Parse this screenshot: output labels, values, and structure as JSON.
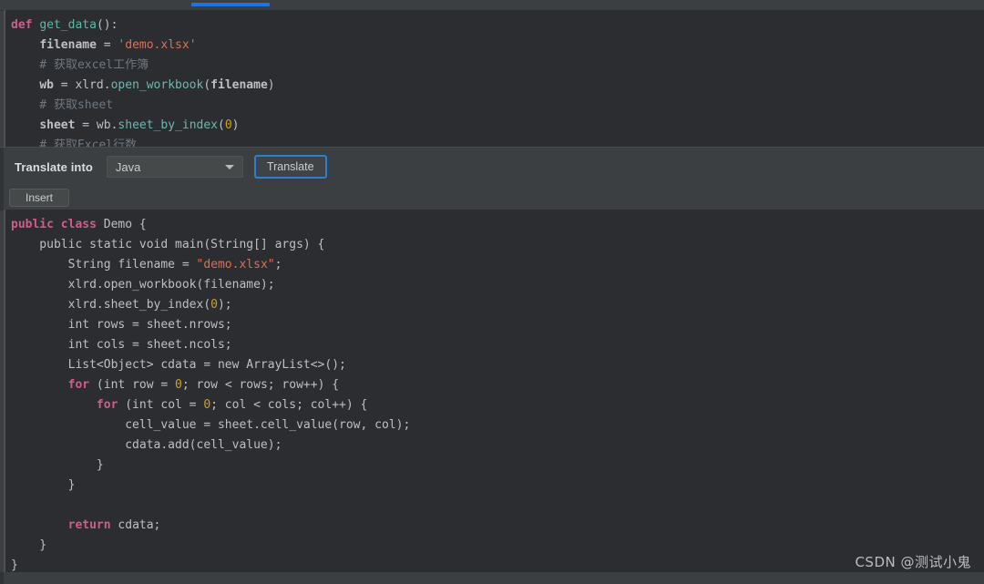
{
  "toolbar": {
    "label": "Translate into",
    "language_selected": "Java",
    "language_options": [
      "Java"
    ],
    "translate_button": "Translate",
    "insert_button": "Insert",
    "accent_color": "#2d7fd3"
  },
  "source_editor": {
    "language": "Python",
    "lines": [
      [
        {
          "t": "def",
          "c": "kw"
        },
        {
          "t": " ",
          "c": "pln"
        },
        {
          "t": "get_data",
          "c": "fn"
        },
        {
          "t": "():",
          "c": "pln"
        }
      ],
      [
        {
          "t": "    ",
          "c": "pln"
        },
        {
          "t": "filename",
          "c": "bld"
        },
        {
          "t": " = ",
          "c": "pln"
        },
        {
          "t": "'demo.xlsx'",
          "c": "str"
        }
      ],
      [
        {
          "t": "    # 获取excel工作簿",
          "c": "cmt"
        }
      ],
      [
        {
          "t": "    ",
          "c": "pln"
        },
        {
          "t": "wb",
          "c": "bld"
        },
        {
          "t": " = xlrd.",
          "c": "pln"
        },
        {
          "t": "open_workbook",
          "c": "mth"
        },
        {
          "t": "(",
          "c": "pln"
        },
        {
          "t": "filename",
          "c": "bld"
        },
        {
          "t": ")",
          "c": "pln"
        }
      ],
      [
        {
          "t": "    # 获取sheet",
          "c": "cmt"
        }
      ],
      [
        {
          "t": "    ",
          "c": "pln"
        },
        {
          "t": "sheet",
          "c": "bld"
        },
        {
          "t": " = wb.",
          "c": "pln"
        },
        {
          "t": "sheet_by_index",
          "c": "mth"
        },
        {
          "t": "(",
          "c": "pln"
        },
        {
          "t": "0",
          "c": "num"
        },
        {
          "t": ")",
          "c": "pln"
        }
      ],
      [
        {
          "t": "    # 获取Excel行数",
          "c": "cmt"
        }
      ]
    ]
  },
  "result_editor": {
    "language": "Java",
    "lines": [
      [
        {
          "t": "public ",
          "c": "kw"
        },
        {
          "t": "class ",
          "c": "kw"
        },
        {
          "t": "Demo {",
          "c": "pln"
        }
      ],
      [
        {
          "t": "    public static void main(String[] args) {",
          "c": "pln"
        }
      ],
      [
        {
          "t": "        String filename = ",
          "c": "pln"
        },
        {
          "t": "\"demo.xlsx\"",
          "c": "str"
        },
        {
          "t": ";",
          "c": "pln"
        }
      ],
      [
        {
          "t": "        xlrd.open_workbook(filename);",
          "c": "pln"
        }
      ],
      [
        {
          "t": "        xlrd.sheet_by_index(",
          "c": "pln"
        },
        {
          "t": "0",
          "c": "num"
        },
        {
          "t": ");",
          "c": "pln"
        }
      ],
      [
        {
          "t": "        int rows = sheet.nrows;",
          "c": "pln"
        }
      ],
      [
        {
          "t": "        int cols = sheet.ncols;",
          "c": "pln"
        }
      ],
      [
        {
          "t": "        List<Object> cdata = new ArrayList<>();",
          "c": "pln"
        }
      ],
      [
        {
          "t": "        ",
          "c": "pln"
        },
        {
          "t": "for",
          "c": "kw"
        },
        {
          "t": " (int row = ",
          "c": "pln"
        },
        {
          "t": "0",
          "c": "num"
        },
        {
          "t": "; row < rows; row++) {",
          "c": "pln"
        }
      ],
      [
        {
          "t": "            ",
          "c": "pln"
        },
        {
          "t": "for",
          "c": "kw"
        },
        {
          "t": " (int col = ",
          "c": "pln"
        },
        {
          "t": "0",
          "c": "num"
        },
        {
          "t": "; col < cols; col++) {",
          "c": "pln"
        }
      ],
      [
        {
          "t": "                cell_value = sheet.cell_value(row, col);",
          "c": "pln"
        }
      ],
      [
        {
          "t": "                cdata.add(cell_value);",
          "c": "pln"
        }
      ],
      [
        {
          "t": "            }",
          "c": "pln"
        }
      ],
      [
        {
          "t": "        }",
          "c": "pln"
        }
      ],
      [
        {
          "t": "",
          "c": "pln"
        }
      ],
      [
        {
          "t": "        ",
          "c": "pln"
        },
        {
          "t": "return",
          "c": "kw"
        },
        {
          "t": " cdata;",
          "c": "pln"
        }
      ],
      [
        {
          "t": "    }",
          "c": "pln"
        }
      ],
      [
        {
          "t": "}",
          "c": "pln"
        }
      ]
    ]
  },
  "watermark": {
    "text": "CSDN @测试小鬼"
  }
}
